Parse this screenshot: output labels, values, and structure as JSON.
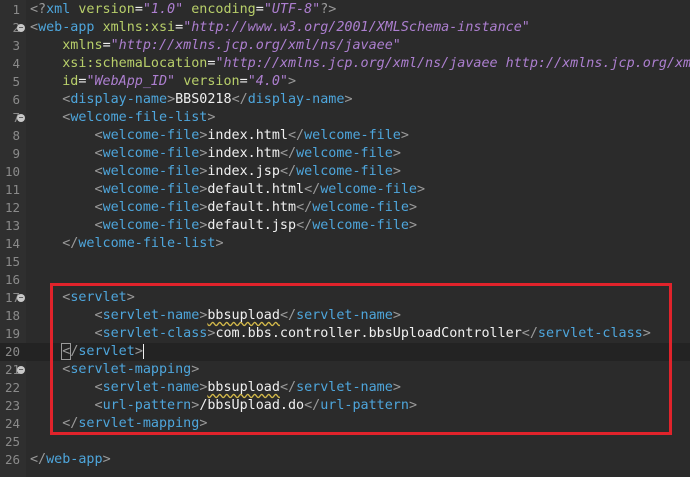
{
  "editor": {
    "lines": [
      {
        "n": "1",
        "fold": false,
        "parts": [
          [
            "br",
            "<?"
          ],
          [
            "tag",
            "xml"
          ],
          [
            "txt",
            " "
          ],
          [
            "attr",
            "version"
          ],
          [
            "txt",
            "="
          ],
          [
            "val",
            "\"1.0\""
          ],
          [
            "txt",
            " "
          ],
          [
            "attr",
            "encoding"
          ],
          [
            "txt",
            "="
          ],
          [
            "val",
            "\"UTF-8\""
          ],
          [
            "br",
            "?>"
          ]
        ]
      },
      {
        "n": "2",
        "fold": true,
        "parts": [
          [
            "br",
            "<"
          ],
          [
            "tag",
            "web-app"
          ],
          [
            "txt",
            " "
          ],
          [
            "attr",
            "xmlns:xsi"
          ],
          [
            "txt",
            "="
          ],
          [
            "val",
            "\"http://www.w3.org/2001/XMLSchema-instance\""
          ]
        ]
      },
      {
        "n": "3",
        "fold": false,
        "parts": [
          [
            "txt",
            "    "
          ],
          [
            "attr",
            "xmlns"
          ],
          [
            "txt",
            "="
          ],
          [
            "val",
            "\"http://xmlns.jcp.org/xml/ns/javaee\""
          ]
        ]
      },
      {
        "n": "4",
        "fold": false,
        "parts": [
          [
            "txt",
            "    "
          ],
          [
            "attr",
            "xsi:schemaLocation"
          ],
          [
            "txt",
            "="
          ],
          [
            "val",
            "\"http://xmlns.jcp.org/xml/ns/javaee http://xmlns.jcp.org/xm"
          ]
        ]
      },
      {
        "n": "5",
        "fold": false,
        "parts": [
          [
            "txt",
            "    "
          ],
          [
            "attr",
            "id"
          ],
          [
            "txt",
            "="
          ],
          [
            "val",
            "\"WebApp_ID\""
          ],
          [
            "txt",
            " "
          ],
          [
            "attr",
            "version"
          ],
          [
            "txt",
            "="
          ],
          [
            "val",
            "\"4.0\""
          ],
          [
            "br",
            ">"
          ]
        ]
      },
      {
        "n": "6",
        "fold": false,
        "parts": [
          [
            "txt",
            "    "
          ],
          [
            "br",
            "<"
          ],
          [
            "tag",
            "display-name"
          ],
          [
            "br",
            ">"
          ],
          [
            "txt",
            "BBS0218"
          ],
          [
            "br",
            "</"
          ],
          [
            "tag",
            "display-name"
          ],
          [
            "br",
            ">"
          ]
        ]
      },
      {
        "n": "7",
        "fold": true,
        "parts": [
          [
            "txt",
            "    "
          ],
          [
            "br",
            "<"
          ],
          [
            "tag",
            "welcome-file-list"
          ],
          [
            "br",
            ">"
          ]
        ]
      },
      {
        "n": "8",
        "fold": false,
        "parts": [
          [
            "txt",
            "        "
          ],
          [
            "br",
            "<"
          ],
          [
            "tag",
            "welcome-file"
          ],
          [
            "br",
            ">"
          ],
          [
            "txt",
            "index.html"
          ],
          [
            "br",
            "</"
          ],
          [
            "tag",
            "welcome-file"
          ],
          [
            "br",
            ">"
          ]
        ]
      },
      {
        "n": "9",
        "fold": false,
        "parts": [
          [
            "txt",
            "        "
          ],
          [
            "br",
            "<"
          ],
          [
            "tag",
            "welcome-file"
          ],
          [
            "br",
            ">"
          ],
          [
            "txt",
            "index.htm"
          ],
          [
            "br",
            "</"
          ],
          [
            "tag",
            "welcome-file"
          ],
          [
            "br",
            ">"
          ]
        ]
      },
      {
        "n": "10",
        "fold": false,
        "parts": [
          [
            "txt",
            "        "
          ],
          [
            "br",
            "<"
          ],
          [
            "tag",
            "welcome-file"
          ],
          [
            "br",
            ">"
          ],
          [
            "txt",
            "index.jsp"
          ],
          [
            "br",
            "</"
          ],
          [
            "tag",
            "welcome-file"
          ],
          [
            "br",
            ">"
          ]
        ]
      },
      {
        "n": "11",
        "fold": false,
        "parts": [
          [
            "txt",
            "        "
          ],
          [
            "br",
            "<"
          ],
          [
            "tag",
            "welcome-file"
          ],
          [
            "br",
            ">"
          ],
          [
            "txt",
            "default.html"
          ],
          [
            "br",
            "</"
          ],
          [
            "tag",
            "welcome-file"
          ],
          [
            "br",
            ">"
          ]
        ]
      },
      {
        "n": "12",
        "fold": false,
        "parts": [
          [
            "txt",
            "        "
          ],
          [
            "br",
            "<"
          ],
          [
            "tag",
            "welcome-file"
          ],
          [
            "br",
            ">"
          ],
          [
            "txt",
            "default.htm"
          ],
          [
            "br",
            "</"
          ],
          [
            "tag",
            "welcome-file"
          ],
          [
            "br",
            ">"
          ]
        ]
      },
      {
        "n": "13",
        "fold": false,
        "parts": [
          [
            "txt",
            "        "
          ],
          [
            "br",
            "<"
          ],
          [
            "tag",
            "welcome-file"
          ],
          [
            "br",
            ">"
          ],
          [
            "txt",
            "default.jsp"
          ],
          [
            "br",
            "</"
          ],
          [
            "tag",
            "welcome-file"
          ],
          [
            "br",
            ">"
          ]
        ]
      },
      {
        "n": "14",
        "fold": false,
        "parts": [
          [
            "txt",
            "    "
          ],
          [
            "br",
            "</"
          ],
          [
            "tag",
            "welcome-file-list"
          ],
          [
            "br",
            ">"
          ]
        ]
      },
      {
        "n": "15",
        "fold": false,
        "parts": []
      },
      {
        "n": "16",
        "fold": false,
        "parts": []
      },
      {
        "n": "17",
        "fold": true,
        "parts": [
          [
            "txt",
            "    "
          ],
          [
            "br",
            "<"
          ],
          [
            "tag",
            "servlet"
          ],
          [
            "br",
            ">"
          ]
        ]
      },
      {
        "n": "18",
        "fold": false,
        "parts": [
          [
            "txt",
            "        "
          ],
          [
            "br",
            "<"
          ],
          [
            "tag",
            "servlet-name"
          ],
          [
            "br",
            ">"
          ],
          [
            "squig",
            "bbsupload"
          ],
          [
            "br",
            "</"
          ],
          [
            "tag",
            "servlet-name"
          ],
          [
            "br",
            ">"
          ]
        ]
      },
      {
        "n": "19",
        "fold": false,
        "parts": [
          [
            "txt",
            "        "
          ],
          [
            "br",
            "<"
          ],
          [
            "tag",
            "servlet-class"
          ],
          [
            "br",
            ">"
          ],
          [
            "txt",
            "com.bbs.controller.bbsUploadController"
          ],
          [
            "br",
            "</"
          ],
          [
            "tag",
            "servlet-class"
          ],
          [
            "br",
            ">"
          ]
        ]
      },
      {
        "n": "20",
        "fold": false,
        "current": true,
        "parts": [
          [
            "txt",
            "    "
          ],
          [
            "hlbr",
            "<"
          ],
          [
            "br",
            "/"
          ],
          [
            "tag",
            "servlet"
          ],
          [
            "br",
            ">"
          ],
          [
            "caret",
            ""
          ]
        ]
      },
      {
        "n": "21",
        "fold": true,
        "parts": [
          [
            "txt",
            "    "
          ],
          [
            "br",
            "<"
          ],
          [
            "tag",
            "servlet-mapping"
          ],
          [
            "br",
            ">"
          ]
        ]
      },
      {
        "n": "22",
        "fold": false,
        "parts": [
          [
            "txt",
            "        "
          ],
          [
            "br",
            "<"
          ],
          [
            "tag",
            "servlet-name"
          ],
          [
            "br",
            ">"
          ],
          [
            "squig",
            "bbsupload"
          ],
          [
            "br",
            "</"
          ],
          [
            "tag",
            "servlet-name"
          ],
          [
            "br",
            ">"
          ]
        ]
      },
      {
        "n": "23",
        "fold": false,
        "parts": [
          [
            "txt",
            "        "
          ],
          [
            "br",
            "<"
          ],
          [
            "tag",
            "url-pattern"
          ],
          [
            "br",
            ">"
          ],
          [
            "txt",
            "/bbsUpload.do"
          ],
          [
            "br",
            "</"
          ],
          [
            "tag",
            "url-pattern"
          ],
          [
            "br",
            ">"
          ]
        ]
      },
      {
        "n": "24",
        "fold": false,
        "parts": [
          [
            "txt",
            "    "
          ],
          [
            "br",
            "</"
          ],
          [
            "tag",
            "servlet-mapping"
          ],
          [
            "br",
            ">"
          ]
        ]
      },
      {
        "n": "25",
        "fold": false,
        "parts": []
      },
      {
        "n": "26",
        "fold": false,
        "parts": [
          [
            "br",
            "</"
          ],
          [
            "tag",
            "web-app"
          ],
          [
            "br",
            ">"
          ]
        ]
      }
    ]
  },
  "colors": {
    "background": "#2b2b2b",
    "tag": "#4ea6dc",
    "attribute": "#b8cf6a",
    "value": "#ad7fd0",
    "highlight_box": "#e0232b"
  },
  "icons": {
    "fold_marker": "fold-collapse-icon"
  }
}
